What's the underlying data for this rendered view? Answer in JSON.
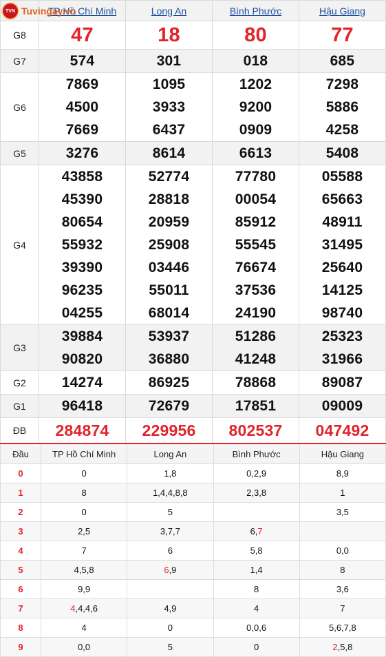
{
  "logo": {
    "text": "Tuvingay.vn",
    "badge": "TVN"
  },
  "provinces": [
    "TP Hồ Chí Minh",
    "Long An",
    "Bình Phước",
    "Hậu Giang"
  ],
  "prizes": {
    "g8": {
      "label": "G8",
      "values": [
        "47",
        "18",
        "80",
        "77"
      ]
    },
    "g7": {
      "label": "G7",
      "values": [
        "574",
        "301",
        "018",
        "685"
      ]
    },
    "g6": {
      "label": "G6",
      "values": [
        [
          "7869",
          "4500",
          "7669"
        ],
        [
          "1095",
          "3933",
          "6437"
        ],
        [
          "1202",
          "9200",
          "0909"
        ],
        [
          "7298",
          "5886",
          "4258"
        ]
      ]
    },
    "g5": {
      "label": "G5",
      "values": [
        "3276",
        "8614",
        "6613",
        "5408"
      ]
    },
    "g4": {
      "label": "G4",
      "values": [
        [
          "43858",
          "45390",
          "80654",
          "55932",
          "39390",
          "96235",
          "04255"
        ],
        [
          "52774",
          "28818",
          "20959",
          "25908",
          "03446",
          "55011",
          "68014"
        ],
        [
          "77780",
          "00054",
          "85912",
          "55545",
          "76674",
          "37536",
          "24190"
        ],
        [
          "05588",
          "65663",
          "48911",
          "31495",
          "25640",
          "14125",
          "98740"
        ]
      ]
    },
    "g3": {
      "label": "G3",
      "values": [
        [
          "39884",
          "90820"
        ],
        [
          "53937",
          "36880"
        ],
        [
          "51286",
          "41248"
        ],
        [
          "25323",
          "31966"
        ]
      ]
    },
    "g2": {
      "label": "G2",
      "values": [
        "14274",
        "86925",
        "78868",
        "89087"
      ]
    },
    "g1": {
      "label": "G1",
      "values": [
        "96418",
        "72679",
        "17851",
        "09009"
      ]
    },
    "db": {
      "label": "ĐB",
      "values": [
        "284874",
        "229956",
        "802537",
        "047492"
      ]
    }
  },
  "loto": {
    "header_dau": "Đầu",
    "rows": [
      {
        "dau": "0",
        "cells": [
          [
            [
              "0",
              false
            ]
          ],
          [
            [
              "1,8",
              false
            ]
          ],
          [
            [
              "0,2,9",
              false
            ]
          ],
          [
            [
              "8,9",
              false
            ]
          ]
        ]
      },
      {
        "dau": "1",
        "cells": [
          [
            [
              "8",
              false
            ]
          ],
          [
            [
              "1,4,4,8,8",
              false
            ]
          ],
          [
            [
              "2,3,8",
              false
            ]
          ],
          [
            [
              "1",
              false
            ]
          ]
        ]
      },
      {
        "dau": "2",
        "cells": [
          [
            [
              "0",
              false
            ]
          ],
          [
            [
              "5",
              false
            ]
          ],
          [],
          [
            [
              "3,5",
              false
            ]
          ]
        ]
      },
      {
        "dau": "3",
        "cells": [
          [
            [
              "2,5",
              false
            ]
          ],
          [
            [
              "3,7,7",
              false
            ]
          ],
          [
            [
              "6,",
              false
            ],
            [
              "7",
              true
            ]
          ],
          []
        ]
      },
      {
        "dau": "4",
        "cells": [
          [
            [
              "7",
              false
            ]
          ],
          [
            [
              "6",
              false
            ]
          ],
          [
            [
              "5,8",
              false
            ]
          ],
          [
            [
              "0,0",
              false
            ]
          ]
        ]
      },
      {
        "dau": "5",
        "cells": [
          [
            [
              "4,5,8",
              false
            ]
          ],
          [
            [
              "6",
              true
            ],
            [
              ",9",
              false
            ]
          ],
          [
            [
              "1,4",
              false
            ]
          ],
          [
            [
              "8",
              false
            ]
          ]
        ]
      },
      {
        "dau": "6",
        "cells": [
          [
            [
              "9,9",
              false
            ]
          ],
          [],
          [
            [
              "8",
              false
            ]
          ],
          [
            [
              "3,6",
              false
            ]
          ]
        ]
      },
      {
        "dau": "7",
        "cells": [
          [
            [
              "4",
              true
            ],
            [
              ",4,4,6",
              false
            ]
          ],
          [
            [
              "4,9",
              false
            ]
          ],
          [
            [
              "4",
              false
            ]
          ],
          [
            [
              "7",
              false
            ]
          ]
        ]
      },
      {
        "dau": "8",
        "cells": [
          [
            [
              "4",
              false
            ]
          ],
          [
            [
              "0",
              false
            ]
          ],
          [
            [
              "0,0,6",
              false
            ]
          ],
          [
            [
              "5,6,7,8",
              false
            ]
          ]
        ]
      },
      {
        "dau": "9",
        "cells": [
          [
            [
              "0,0",
              false
            ]
          ],
          [
            [
              "5",
              false
            ]
          ],
          [
            [
              "0",
              false
            ]
          ],
          [
            [
              "2",
              true
            ],
            [
              ",5,8",
              false
            ]
          ]
        ]
      }
    ]
  },
  "colors": {
    "accent_red": "#e2232b",
    "link_blue": "#1f4f9e"
  }
}
